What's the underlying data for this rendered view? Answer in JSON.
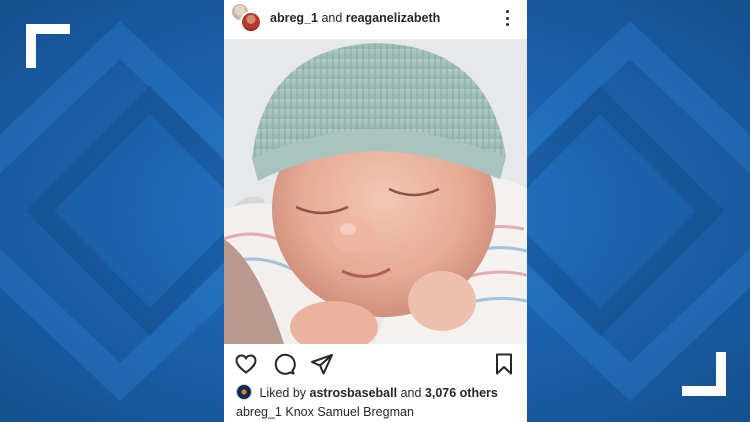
{
  "post": {
    "user1": "abreg_1",
    "joiner": "and",
    "user2": "reaganelizabeth",
    "liked_by_prefix": "Liked by",
    "liked_by_user": "astrosbaseball",
    "liked_by_and": "and",
    "liked_count": "3,076 others",
    "caption_user": "abreg_1",
    "caption_text": "Knox Samuel Bregman"
  },
  "icons": {
    "like": "heart-icon",
    "comment": "comment-icon",
    "share": "send-icon",
    "save": "bookmark-icon",
    "more": "more-options-icon"
  },
  "colors": {
    "background": "#1c64ae",
    "card": "#ffffff",
    "text": "#262626"
  }
}
